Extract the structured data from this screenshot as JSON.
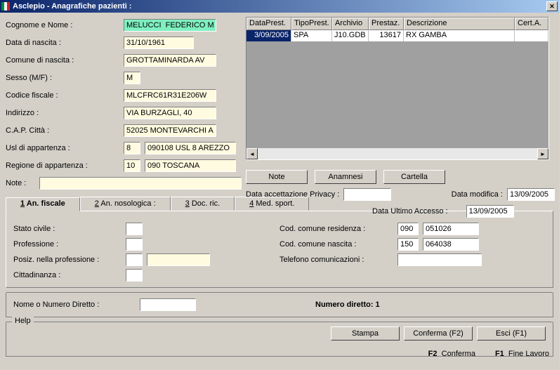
{
  "titlebar": {
    "title": "Asclepio - Anagrafiche pazienti :"
  },
  "form": {
    "cognome_lbl": "Cognome e Nome :",
    "cognome": "MELUCCI  FEDERICO M",
    "dob_lbl": "Data di nascita :",
    "dob": "31/10/1961",
    "comune_lbl": "Comune di nascita :",
    "comune": "GROTTAMINARDA AV",
    "sesso_lbl": "Sesso (M/F) :",
    "sesso": "M",
    "cf_lbl": "Codice fiscale :",
    "cf": "MLCFRC61R31E206W",
    "indirizzo_lbl": "Indirizzo :",
    "indirizzo": "VIA BURZAGLI, 40",
    "cap_lbl": "C.A.P. Città :",
    "cap": "52025 MONTEVARCHI A",
    "usl_lbl": "Usl di appartenza :",
    "usl_code": "8",
    "usl_desc": "090108 USL 8 AREZZO",
    "regione_lbl": "Regione di appartenza :",
    "regione_code": "10",
    "regione_desc": "090 TOSCANA",
    "note_lbl": "Note :"
  },
  "grid": {
    "headers": [
      "DataPrest.",
      "TipoPrest.",
      "Archivio",
      "Prestaz.",
      "Descrizione",
      "Cert.A."
    ],
    "row": [
      "3/09/2005",
      "SPA",
      "J10.GDB",
      "13617",
      "RX GAMBA",
      ""
    ]
  },
  "buttons": {
    "note": "Note",
    "anamnesi": "Anamnesi",
    "cartella": "Cartella",
    "stampa": "Stampa",
    "conferma": "Conferma (F2)",
    "esci": "Esci (F1)"
  },
  "privacy": {
    "label": "Data accettazione Privacy :",
    "mod_lbl": "Data modifica :",
    "mod": "13/09/2005",
    "acc_lbl": "Data Ultimo Accesso :",
    "acc": "13/09/2005"
  },
  "tabs": {
    "t1_num": "1",
    "t1": " An. fiscale",
    "t2_num": "2",
    "t2": " An. nosologica :",
    "t3_num": "3",
    "t3": " Doc. ric.",
    "t4_num": "4",
    "t4": " Med. sport."
  },
  "fiscale": {
    "stato_lbl": "Stato civile :",
    "prof_lbl": "Professione :",
    "posiz_lbl": "Posiz. nella professione :",
    "citt_lbl": "Cittadinanza :",
    "res_lbl": "Cod. comune residenza :",
    "res_code": "090",
    "res_val": "051026",
    "nasc_lbl": "Cod. comune nascita :",
    "nasc_code": "150",
    "nasc_val": "064038",
    "tel_lbl": "Telefono comunicazioni :"
  },
  "direct": {
    "lbl": "Nome o Numero Diretto :",
    "result": "Numero diretto: 1"
  },
  "help": {
    "legend": "Help"
  },
  "status": {
    "f2b": "F2",
    "f2": "Conferma",
    "f1b": "F1",
    "f1": "Fine Lavoro"
  }
}
